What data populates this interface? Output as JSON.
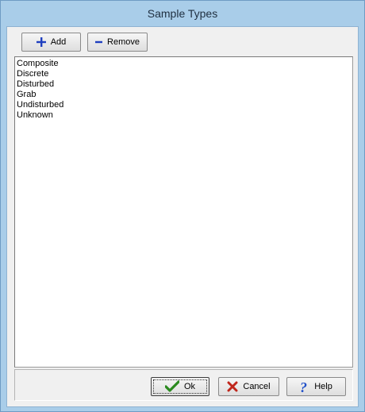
{
  "window": {
    "title": "Sample Types"
  },
  "toolbar": {
    "add_label": "Add",
    "add_icon": "plus-icon",
    "remove_label": "Remove",
    "remove_icon": "minus-icon"
  },
  "list": {
    "items": [
      "Composite",
      "Discrete",
      "Disturbed",
      "Grab",
      "Undisturbed",
      "Unknown"
    ]
  },
  "footer": {
    "ok_label": "Ok",
    "ok_icon": "checkmark-icon",
    "cancel_label": "Cancel",
    "cancel_icon": "x-icon",
    "help_label": "Help",
    "help_icon": "question-mark-icon"
  },
  "colors": {
    "accent_blue": "#1f3fbf",
    "ok_green": "#2a8a1e",
    "cancel_red": "#c0261b",
    "help_blue": "#2150c9"
  }
}
